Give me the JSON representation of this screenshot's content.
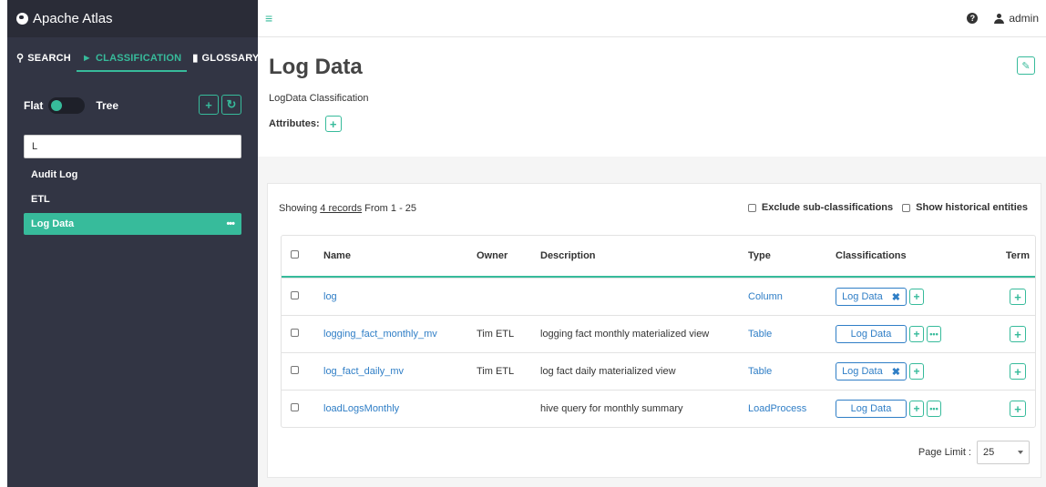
{
  "app": {
    "title": "Apache Atlas"
  },
  "nav": {
    "tabs": [
      {
        "label": "SEARCH",
        "icon": "search-icon"
      },
      {
        "label": "CLASSIFICATION",
        "icon": "tag-icon"
      },
      {
        "label": "GLOSSARY",
        "icon": "folder-icon"
      }
    ],
    "active_tab": "CLASSIFICATION"
  },
  "sidebar": {
    "toggle_left": "Flat",
    "toggle_right": "Tree",
    "filter_value": "L",
    "items": [
      {
        "label": "Audit Log"
      },
      {
        "label": "ETL"
      },
      {
        "label": "Log Data",
        "active": true
      }
    ]
  },
  "header": {
    "user": "admin"
  },
  "detail": {
    "title": "Log Data",
    "description": "LogData Classification",
    "attributes_label": "Attributes:"
  },
  "results": {
    "showing_prefix": "Showing ",
    "showing_link": "4 records",
    "showing_suffix": " From 1 - 25",
    "exclude_sub": "Exclude sub-classifications",
    "show_historical": "Show historical entities",
    "columns": [
      "Name",
      "Owner",
      "Description",
      "Type",
      "Classifications",
      "Term"
    ],
    "rows": [
      {
        "name": "log",
        "owner": "",
        "description": "",
        "type": "Column",
        "tag": "Log Data"
      },
      {
        "name": "logging_fact_monthly_mv",
        "owner": "Tim ETL",
        "description": "logging fact monthly materialized view",
        "type": "Table",
        "tag": "Log Data"
      },
      {
        "name": "log_fact_daily_mv",
        "owner": "Tim ETL",
        "description": "log fact daily materialized view",
        "type": "Table",
        "tag": "Log Data"
      },
      {
        "name": "loadLogsMonthly",
        "owner": "",
        "description": "hive query for monthly summary",
        "type": "LoadProcess",
        "tag": "Log Data"
      }
    ],
    "page_limit_label": "Page Limit :",
    "page_limit_value": "25"
  },
  "colors": {
    "accent": "#37bb9b",
    "link": "#2f7ec6",
    "sidebar_bg": "#323544"
  }
}
